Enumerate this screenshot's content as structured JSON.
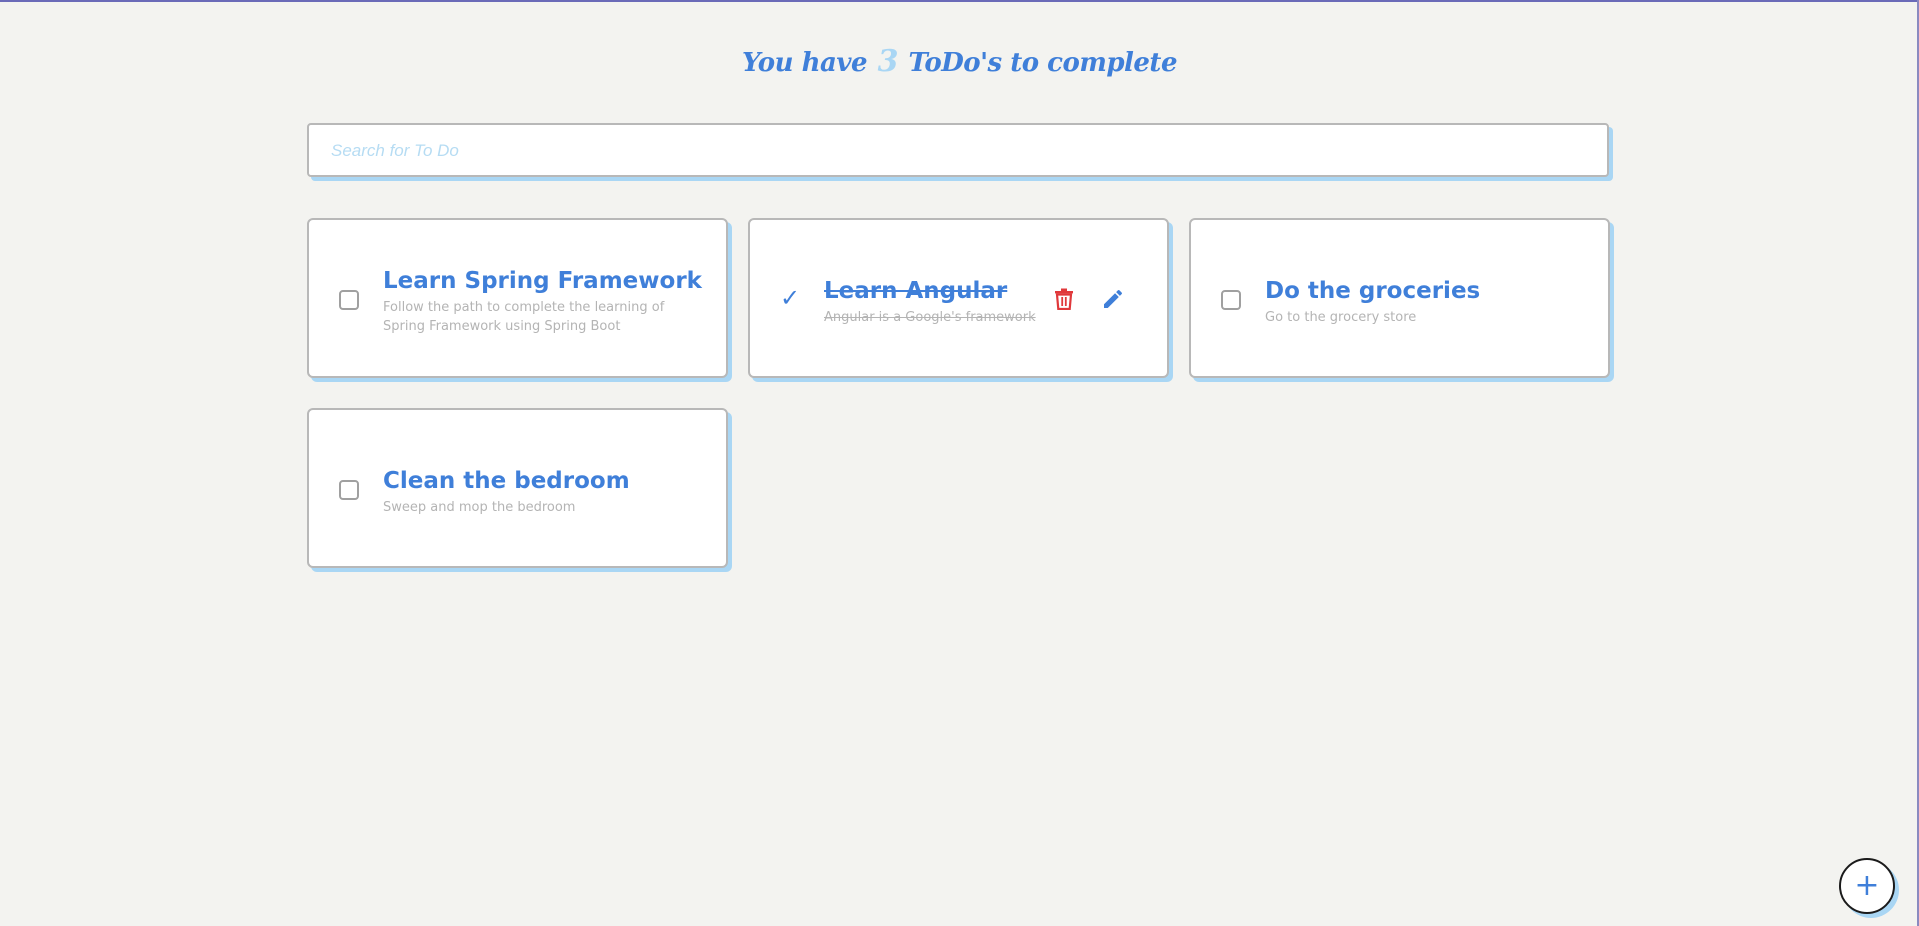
{
  "header": {
    "prefix": "You have",
    "count": "3",
    "suffix": "ToDo's to complete"
  },
  "search": {
    "placeholder": "Search for To Do",
    "value": ""
  },
  "todos": [
    {
      "title": "Learn Spring Framework",
      "description": "Follow the path to complete the learning of Spring Framework using Spring Boot",
      "completed": false
    },
    {
      "title": "Learn Angular",
      "description": "Angular is a Google's framework",
      "completed": true
    },
    {
      "title": "Do the groceries",
      "description": "Go to the grocery store",
      "completed": false
    },
    {
      "title": "Clean the bedroom",
      "description": "Sweep and mop the bedroom",
      "completed": false
    }
  ],
  "icons": {
    "checkmark": "✓",
    "add": "+",
    "delete": "trash-icon",
    "edit": "pencil-icon"
  },
  "colors": {
    "accent": "#3f7fd9",
    "shadow": "#a9d6f4",
    "delete": "#e0383b",
    "background": "#f3f3f0"
  }
}
